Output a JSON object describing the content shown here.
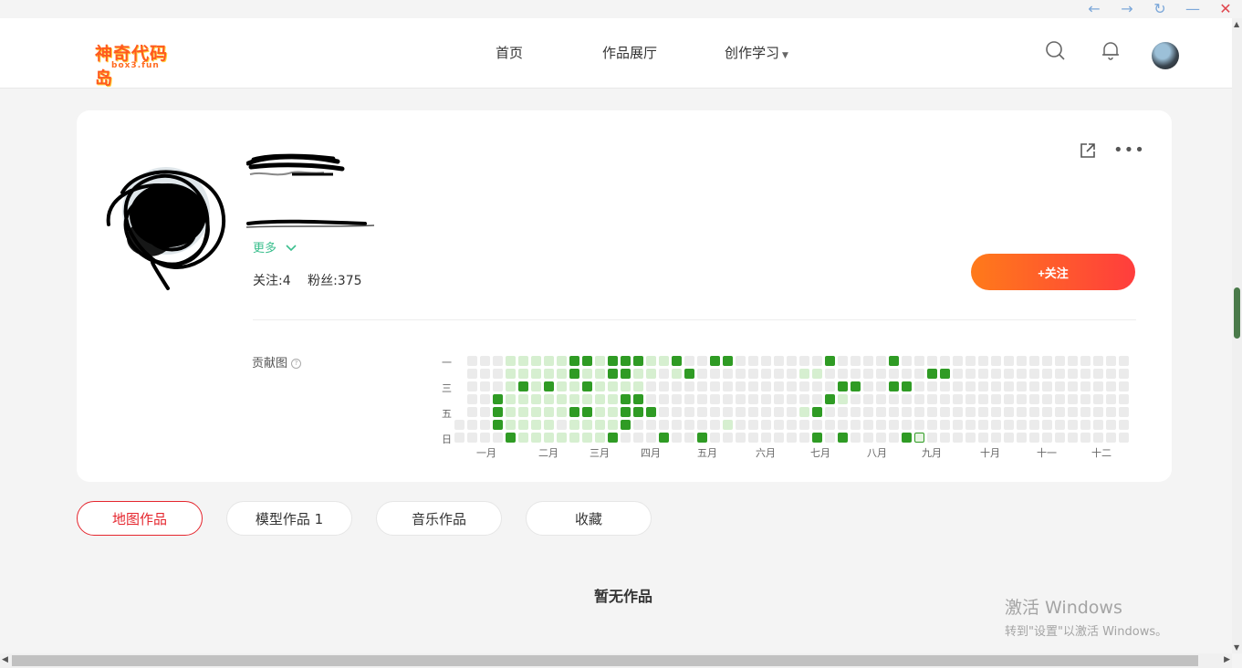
{
  "window": {
    "controls": [
      "←",
      "→",
      "↻",
      "—",
      "✕"
    ]
  },
  "header": {
    "logo_text": "神奇代码岛",
    "logo_sub": "box3.fun",
    "nav": [
      "首页",
      "作品展厅",
      "创作学习"
    ]
  },
  "profile": {
    "more_label": "更多",
    "stats": {
      "following": "关注:4",
      "followers": "粉丝:375"
    },
    "follow_button": "+关注"
  },
  "contribution": {
    "label": "贡献图",
    "weekdays": [
      "一",
      "三",
      "五",
      "日"
    ],
    "months": [
      "一月",
      "二月",
      "三月",
      "四月",
      "五月",
      "六月",
      "七月",
      "八月",
      "九月",
      "十月",
      "十一",
      "十二"
    ],
    "weeks": 53,
    "levels": {
      "dark": [
        [
          9,
          0
        ],
        [
          10,
          0
        ],
        [
          12,
          0
        ],
        [
          13,
          0
        ],
        [
          14,
          0
        ],
        [
          17,
          0
        ],
        [
          20,
          0
        ],
        [
          21,
          0
        ],
        [
          29,
          0
        ],
        [
          34,
          0
        ],
        [
          9,
          1
        ],
        [
          12,
          1
        ],
        [
          13,
          1
        ],
        [
          18,
          1
        ],
        [
          37,
          1
        ],
        [
          38,
          1
        ],
        [
          5,
          2
        ],
        [
          7,
          2
        ],
        [
          10,
          2
        ],
        [
          30,
          2
        ],
        [
          31,
          2
        ],
        [
          34,
          2
        ],
        [
          35,
          2
        ],
        [
          3,
          3
        ],
        [
          13,
          3
        ],
        [
          14,
          3
        ],
        [
          29,
          3
        ],
        [
          3,
          4
        ],
        [
          9,
          4
        ],
        [
          10,
          4
        ],
        [
          13,
          4
        ],
        [
          14,
          4
        ],
        [
          15,
          4
        ],
        [
          28,
          4
        ],
        [
          3,
          5
        ],
        [
          13,
          5
        ],
        [
          4,
          6
        ],
        [
          12,
          6
        ],
        [
          16,
          6
        ],
        [
          19,
          6
        ],
        [
          28,
          6
        ],
        [
          30,
          6
        ],
        [
          35,
          6
        ],
        [
          36,
          6
        ]
      ],
      "light": [
        [
          4,
          0
        ],
        [
          5,
          0
        ],
        [
          6,
          0
        ],
        [
          7,
          0
        ],
        [
          8,
          0
        ],
        [
          11,
          0
        ],
        [
          15,
          0
        ],
        [
          16,
          0
        ],
        [
          4,
          1
        ],
        [
          5,
          1
        ],
        [
          6,
          1
        ],
        [
          7,
          1
        ],
        [
          8,
          1
        ],
        [
          10,
          1
        ],
        [
          11,
          1
        ],
        [
          14,
          1
        ],
        [
          15,
          1
        ],
        [
          17,
          1
        ],
        [
          27,
          1
        ],
        [
          28,
          1
        ],
        [
          4,
          2
        ],
        [
          6,
          2
        ],
        [
          8,
          2
        ],
        [
          9,
          2
        ],
        [
          11,
          2
        ],
        [
          12,
          2
        ],
        [
          13,
          2
        ],
        [
          14,
          2
        ],
        [
          4,
          3
        ],
        [
          5,
          3
        ],
        [
          6,
          3
        ],
        [
          7,
          3
        ],
        [
          8,
          3
        ],
        [
          9,
          3
        ],
        [
          10,
          3
        ],
        [
          11,
          3
        ],
        [
          12,
          3
        ],
        [
          30,
          3
        ],
        [
          4,
          4
        ],
        [
          5,
          4
        ],
        [
          6,
          4
        ],
        [
          7,
          4
        ],
        [
          8,
          4
        ],
        [
          11,
          4
        ],
        [
          12,
          4
        ],
        [
          27,
          4
        ],
        [
          4,
          5
        ],
        [
          5,
          5
        ],
        [
          6,
          5
        ],
        [
          7,
          5
        ],
        [
          9,
          5
        ],
        [
          10,
          5
        ],
        [
          11,
          5
        ],
        [
          12,
          5
        ],
        [
          21,
          5
        ],
        [
          5,
          6
        ],
        [
          6,
          6
        ],
        [
          7,
          6
        ],
        [
          8,
          6
        ],
        [
          9,
          6
        ],
        [
          10,
          6
        ],
        [
          11,
          6
        ]
      ],
      "today": [
        36,
        6
      ]
    }
  },
  "tabs": [
    {
      "label": "地图作品",
      "active": true
    },
    {
      "label": "模型作品 1",
      "active": false
    },
    {
      "label": "音乐作品",
      "active": false
    },
    {
      "label": "收藏",
      "active": false
    }
  ],
  "empty_state": "暂无作品",
  "watermark": {
    "line1": "激活 Windows",
    "line2": "转到\"设置\"以激活 Windows。"
  },
  "colors": {
    "accent": "#e5262e",
    "green_dark": "#2f9b24",
    "green_light": "#d6efd0",
    "follow_gradient": [
      "#ff7a1a",
      "#ff3d3d"
    ]
  }
}
